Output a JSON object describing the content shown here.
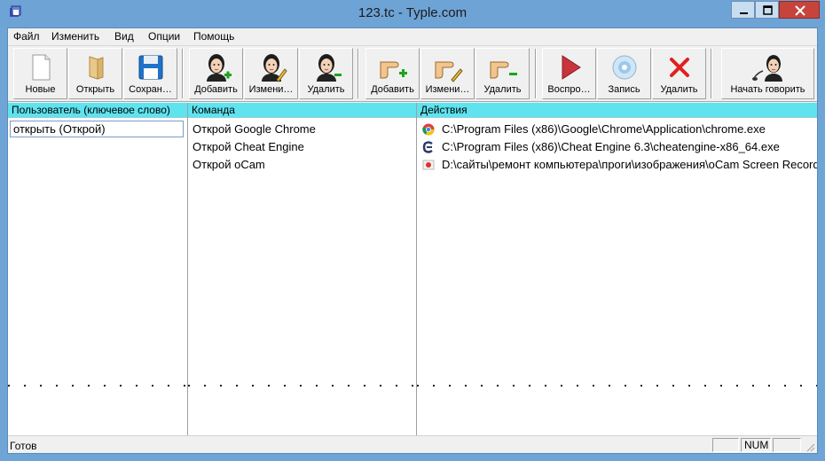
{
  "window": {
    "title": "123.tc - Typle.com"
  },
  "menu": [
    {
      "label": "Файл"
    },
    {
      "label": "Изменить"
    },
    {
      "label": "Вид"
    },
    {
      "label": "Опции"
    },
    {
      "label": "Помощь"
    }
  ],
  "toolbar": {
    "new_label": "Новые",
    "open_label": "Открыть",
    "save_label": "Сохран…",
    "add_user_label": "Добавить",
    "edit_user_label": "Измени…",
    "delete_user_label": "Удалить",
    "add_command_label": "Добавить",
    "edit_command_label": "Измени…",
    "delete_command_label": "Удалить",
    "play_label": "Воспро…",
    "record_label": "Запись",
    "delete_record_label": "Удалить",
    "start_speaking_label": "Начать говорить"
  },
  "panes": {
    "user": {
      "header": "Пользователь (ключевое слово)",
      "items": [
        "открыть (Открой)"
      ]
    },
    "command": {
      "header": "Команда",
      "items": [
        "Открой Google Chrome",
        "Открой Cheat Engine",
        "Открой oCam"
      ]
    },
    "actions": {
      "header": "Действия",
      "items": [
        {
          "icon": "chrome-icon",
          "text": "C:\\Program Files (x86)\\Google\\Chrome\\Application\\chrome.exe"
        },
        {
          "icon": "cheat-engine-icon",
          "text": "C:\\Program Files (x86)\\Cheat Engine 6.3\\cheatengine-x86_64.exe"
        },
        {
          "icon": "ocam-icon",
          "text": "D:\\сайты\\ремонт компьютера\\проги\\изображения\\oCam Screen Recorder"
        }
      ]
    }
  },
  "status": {
    "text": "Готов",
    "num": "NUM"
  },
  "colors": {
    "header_bg": "#5ee3ef",
    "title_bar": "#6ea3d6",
    "close_button": "#c7443c"
  }
}
